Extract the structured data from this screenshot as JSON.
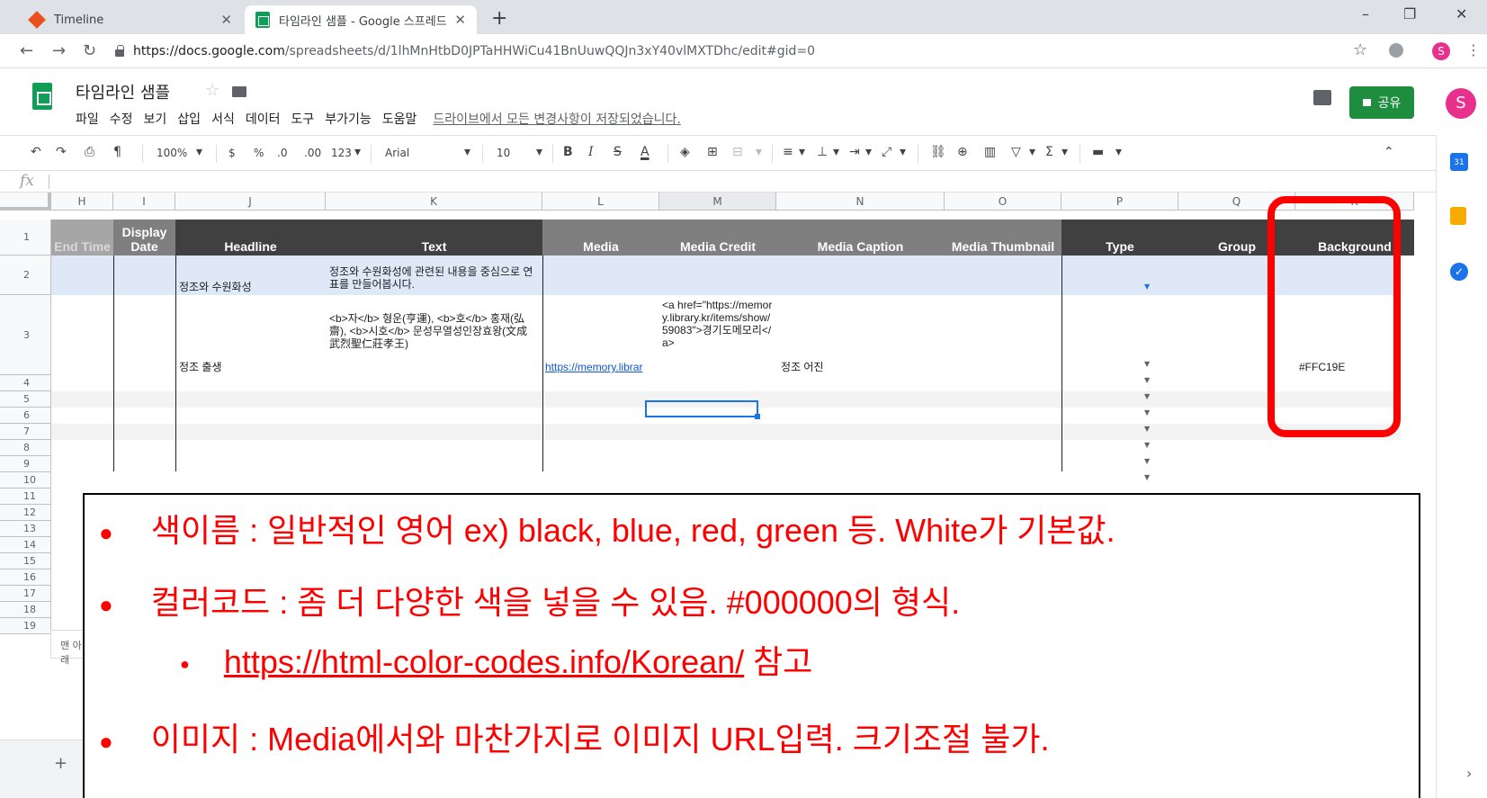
{
  "browser": {
    "tabs": [
      {
        "label": "Timeline",
        "active": false
      },
      {
        "label": "타임라인 샘플 - Google 스프레드",
        "active": true
      }
    ],
    "url_host": "https://docs.google.com",
    "url_path": "/spreadsheets/d/1lhMnHtbD0JPTaHHWiCu41BnUuwQQJn3xY40vlMXTDhc/edit#gid=0",
    "profile_initial": "S"
  },
  "sheets": {
    "title": "타임라인 샘플",
    "menu": [
      "파일",
      "수정",
      "보기",
      "삽입",
      "서식",
      "데이터",
      "도구",
      "부가기능",
      "도움말"
    ],
    "saved_status": "드라이브에서 모든 변경사항이 저장되었습니다.",
    "share_label": "공유",
    "avatar_initial": "S"
  },
  "toolbar": {
    "zoom": "100%",
    "currency": "$",
    "percent": "%",
    "dec_less": ".0",
    "dec_more": ".00",
    "format_more": "123",
    "font": "Arial",
    "font_size": "10",
    "bold": "B",
    "italic": "I",
    "strike": "S",
    "text_color": "A"
  },
  "formula_bar": {
    "label": "fx",
    "value": ""
  },
  "grid": {
    "columns": [
      "H",
      "I",
      "J",
      "K",
      "L",
      "M",
      "N",
      "O",
      "P",
      "Q",
      "R"
    ],
    "selected_column": "M",
    "rows": [
      "1",
      "2",
      "3",
      "4",
      "5",
      "6",
      "7",
      "8",
      "9",
      "10",
      "11",
      "12",
      "13",
      "14",
      "15",
      "16",
      "17",
      "18",
      "19"
    ],
    "header": {
      "end_time": "End Time",
      "display_date": "Display Date",
      "headline": "Headline",
      "text": "Text",
      "media": "Media",
      "media_credit": "Media Credit",
      "media_caption": "Media Caption",
      "media_thumbnail": "Media Thumbnail",
      "type": "Type",
      "group": "Group",
      "background": "Background"
    },
    "row2": {
      "headline": "정조와 수원화성",
      "text": "정조와 수원화성에 관련된 내용을 중심으로 연표를 만들어봅시다."
    },
    "row3": {
      "headline": "정조 출생",
      "text": "<b>자</b> 형운(亨運), <b>호</b> 홍재(弘齋), <b>시호</b> 문성무열성인장효왕(文成武烈聖仁莊孝王)",
      "media": "https://memory.librar",
      "media_credit": "<a href=\"https://memory.library.kr/items/show/59083\">경기도메모리</a>",
      "media_caption": "정조 어진",
      "background": "#FFC19E"
    }
  },
  "sheet_tabs": {
    "to_top": "맨 아래"
  },
  "annotation": {
    "line1": "색이름 : 일반적인 영어 ex) black, blue, red, green 등. White가 기본값.",
    "line2": "컬러코드 : 좀 더 다양한 색을 넣을 수 있음. #000000의 형식.",
    "line3_link": "https://html-color-codes.info/Korean/",
    "line3_suffix": " 참고",
    "line4": "이미지 : Media에서와 마찬가지로 이미지 URL입력. 크기조절 불가."
  },
  "colors": {
    "header_dark": "#404040",
    "header_mid": "#7f7f7f",
    "header_light": "#a6a6a6",
    "highlight": "#ff0000",
    "share_green": "#1e8e3e",
    "row_selected": "#dfe8f7"
  }
}
